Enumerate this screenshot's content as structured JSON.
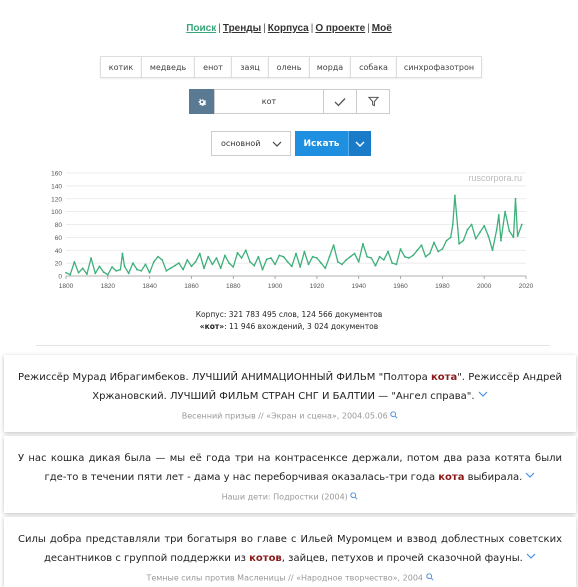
{
  "nav": {
    "items": [
      "Поиск",
      "Тренды",
      "Корпуса",
      "О проекте",
      "Моё"
    ],
    "separator": "|"
  },
  "words": [
    "котик",
    "медведь",
    "енот",
    "заяц",
    "олень",
    "морда",
    "собака",
    "синхрофазотрон"
  ],
  "search": {
    "query": "кот",
    "corpus": "основной",
    "button": "Искать"
  },
  "chart_data": {
    "type": "line",
    "watermark": "ruscorpora.ru",
    "x_ticks": [
      "1800",
      "1820",
      "1840",
      "1860",
      "1880",
      "1900",
      "1920",
      "1940",
      "1960",
      "1980",
      "2000",
      "2020"
    ],
    "y_ticks": [
      "0",
      "20",
      "40",
      "60",
      "80",
      "100",
      "120",
      "140",
      "160"
    ],
    "xlim": [
      1800,
      2020
    ],
    "ylim": [
      0,
      160
    ],
    "series": [
      {
        "color": "#3db07a",
        "x": [
          1800,
          1802,
          1804,
          1806,
          1808,
          1810,
          1812,
          1814,
          1816,
          1818,
          1820,
          1822,
          1824,
          1826,
          1827,
          1828,
          1830,
          1832,
          1834,
          1836,
          1838,
          1840,
          1842,
          1844,
          1846,
          1848,
          1850,
          1852,
          1854,
          1856,
          1858,
          1860,
          1862,
          1864,
          1866,
          1868,
          1870,
          1872,
          1874,
          1876,
          1878,
          1880,
          1882,
          1884,
          1886,
          1888,
          1890,
          1892,
          1894,
          1896,
          1898,
          1900,
          1902,
          1904,
          1906,
          1908,
          1910,
          1912,
          1914,
          1916,
          1918,
          1920,
          1922,
          1924,
          1926,
          1928,
          1930,
          1932,
          1934,
          1936,
          1938,
          1940,
          1942,
          1944,
          1946,
          1948,
          1950,
          1952,
          1954,
          1956,
          1958,
          1960,
          1962,
          1964,
          1966,
          1968,
          1970,
          1972,
          1974,
          1976,
          1978,
          1980,
          1982,
          1984,
          1985,
          1986,
          1988,
          1990,
          1992,
          1994,
          1996,
          1998,
          2000,
          2002,
          2004,
          2006,
          2007,
          2008,
          2010,
          2012,
          2014,
          2015,
          2016,
          2018
        ],
        "values": [
          5,
          2,
          22,
          5,
          12,
          3,
          28,
          4,
          15,
          6,
          2,
          14,
          8,
          10,
          35,
          15,
          4,
          20,
          10,
          8,
          18,
          5,
          22,
          30,
          25,
          8,
          12,
          16,
          20,
          10,
          25,
          15,
          22,
          35,
          12,
          30,
          18,
          28,
          12,
          32,
          20,
          14,
          36,
          28,
          40,
          22,
          16,
          30,
          10,
          26,
          28,
          18,
          32,
          30,
          22,
          15,
          35,
          14,
          38,
          18,
          30,
          28,
          20,
          12,
          30,
          48,
          22,
          18,
          25,
          30,
          35,
          22,
          50,
          30,
          28,
          16,
          30,
          25,
          38,
          20,
          18,
          42,
          30,
          28,
          32,
          40,
          48,
          30,
          35,
          52,
          38,
          42,
          55,
          60,
          80,
          125,
          50,
          55,
          72,
          80,
          58,
          68,
          78,
          62,
          40,
          72,
          95,
          55,
          100,
          70,
          60,
          120,
          62,
          80
        ]
      }
    ]
  },
  "corpus_stats": {
    "line1": "Корпус: 321 783 495 слов, 124 566 документов",
    "query_word": "«кот»",
    "line2_rest": ": 11 946 вхождений, 3 024 документов"
  },
  "results": [
    {
      "text_before": "Режиссёр Мурад Ибрагимбеков. ЛУЧШИЙ АНИМАЦИОННЫЙ ФИЛЬМ \"Полтора ",
      "highlight": "кота",
      "text_after": "\". Режиссёр Андрей Хржановский. ЛУЧШИЙ ФИЛЬМ СТРАН СНГ И БАЛТИИ — \"Ангел справа\".",
      "source": "Весенний призыв // «Экран и сцена», 2004.05.06"
    },
    {
      "text_before": "У нас кошка дикая была — мы её года три на контрасенксе держали, потом два раза котята были где-то в течении пяти лет - дама у нас переборчивая оказалась-три года ",
      "highlight": "кота",
      "text_after": " выбирала.",
      "source": "Наши дети: Подростки (2004)"
    },
    {
      "text_before": "Силы добра представляли три богатыря во главе с Ильей Муромцем и взвод доблестных советских десантников с группой поддержки из ",
      "highlight": "котов",
      "text_after": ", зайцев, петухов и прочей сказочной фауны.",
      "source": "Темные силы против Масленицы // «Народное творчество», 2004"
    }
  ]
}
